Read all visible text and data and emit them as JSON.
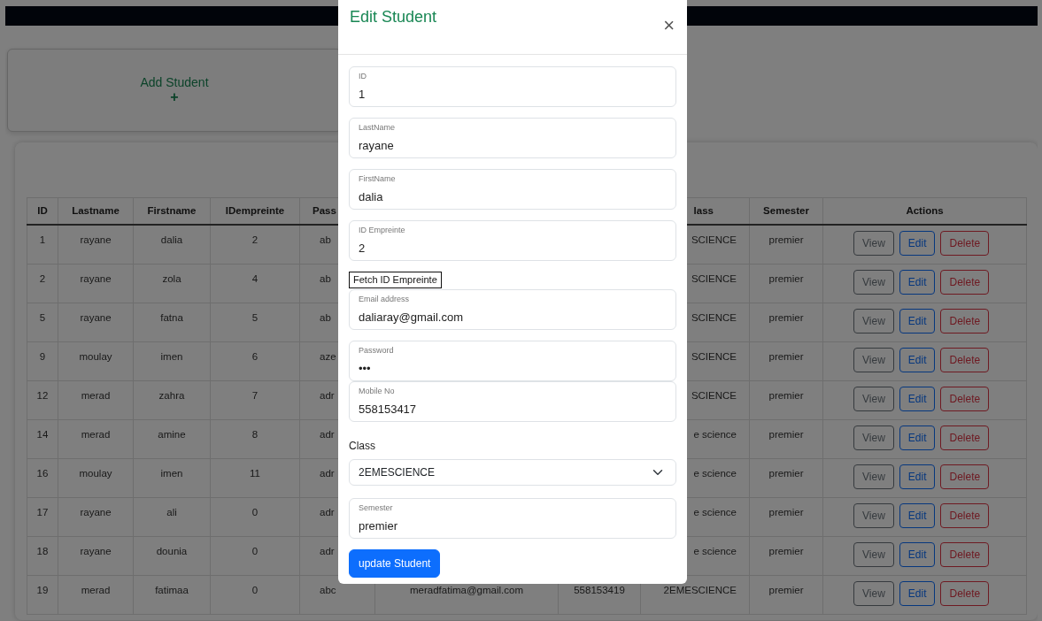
{
  "add_card": {
    "label": "Add Student",
    "icon": "+"
  },
  "table": {
    "columns": [
      "ID",
      "Lastname",
      "Firstname",
      "IDempreinte",
      "Pass",
      null,
      null,
      "lass",
      "Semester",
      "Actions"
    ],
    "rows": [
      {
        "cells": [
          "1",
          "rayane",
          "dalia",
          "2",
          "ab",
          null,
          null,
          "SCIENCE",
          "premier"
        ],
        "actions": [
          {
            "label": "View",
            "kind": "secondary"
          },
          {
            "label": "Edit",
            "kind": "primary"
          },
          {
            "label": "Delete",
            "kind": "danger"
          }
        ]
      },
      {
        "cells": [
          "2",
          "rayane",
          "zola",
          "4",
          "ab",
          null,
          null,
          "SCIENCE",
          "premier"
        ],
        "actions": [
          {
            "label": "View",
            "kind": "secondary"
          },
          {
            "label": "Edit",
            "kind": "primary"
          },
          {
            "label": "Delete",
            "kind": "danger"
          }
        ]
      },
      {
        "cells": [
          "5",
          "rayane",
          "fatna",
          "5",
          "ab",
          null,
          null,
          "SCIENCE",
          "premier"
        ],
        "actions": [
          {
            "label": "View",
            "kind": "secondary"
          },
          {
            "label": "Edit",
            "kind": "primary"
          },
          {
            "label": "Delete",
            "kind": "danger"
          }
        ]
      },
      {
        "cells": [
          "9",
          "moulay",
          "imen",
          "6",
          "aze",
          null,
          null,
          "SCIENCE",
          "premier"
        ],
        "actions": [
          {
            "label": "View",
            "kind": "secondary"
          },
          {
            "label": "Edit",
            "kind": "primary"
          },
          {
            "label": "Delete",
            "kind": "danger"
          }
        ]
      },
      {
        "cells": [
          "12",
          "merad",
          "zahra",
          "7",
          "adr",
          null,
          null,
          "SCIENCE",
          "premier"
        ],
        "actions": [
          {
            "label": "View",
            "kind": "secondary"
          },
          {
            "label": "Edit",
            "kind": "primary"
          },
          {
            "label": "Delete",
            "kind": "danger"
          }
        ]
      },
      {
        "cells": [
          "14",
          "merad",
          "amine",
          "8",
          "adr",
          null,
          null,
          "e science",
          "premier"
        ],
        "actions": [
          {
            "label": "View",
            "kind": "secondary"
          },
          {
            "label": "Edit",
            "kind": "primary"
          },
          {
            "label": "Delete",
            "kind": "danger"
          }
        ]
      },
      {
        "cells": [
          "16",
          "moulay",
          "imen",
          "11",
          "adr",
          null,
          null,
          "e science",
          "premier"
        ],
        "actions": [
          {
            "label": "View",
            "kind": "secondary"
          },
          {
            "label": "Edit",
            "kind": "primary"
          },
          {
            "label": "Delete",
            "kind": "danger"
          }
        ]
      },
      {
        "cells": [
          "17",
          "rayane",
          "ali",
          "0",
          "adr",
          null,
          null,
          "e science",
          "premier"
        ],
        "actions": [
          {
            "label": "View",
            "kind": "secondary"
          },
          {
            "label": "Edit",
            "kind": "primary"
          },
          {
            "label": "Delete",
            "kind": "danger"
          }
        ]
      },
      {
        "cells": [
          "18",
          "rayane",
          "dounia",
          "0",
          "adr",
          null,
          null,
          "e science",
          "premier"
        ],
        "actions": [
          {
            "label": "View",
            "kind": "secondary"
          },
          {
            "label": "Edit",
            "kind": "primary"
          },
          {
            "label": "Delete",
            "kind": "danger"
          }
        ]
      },
      {
        "cells": [
          "19",
          "merad",
          "fatimaa",
          "0",
          "abc",
          "meradfatima@gmail.com",
          "558153419",
          "2EMESCIENCE",
          "premier"
        ],
        "actions": [
          {
            "label": "View",
            "kind": "secondary"
          },
          {
            "label": "Edit",
            "kind": "primary"
          },
          {
            "label": "Delete",
            "kind": "danger"
          }
        ]
      }
    ]
  },
  "modal": {
    "title": "Edit Student",
    "close": "×",
    "fields": [
      {
        "kind": "floating",
        "label": "ID",
        "value": "1"
      },
      {
        "kind": "floating",
        "label": "LastName",
        "value": "rayane"
      },
      {
        "kind": "floating",
        "label": "FirstName",
        "value": "dalia"
      },
      {
        "kind": "floating",
        "label": "ID Empreinte",
        "value": "2"
      },
      {
        "kind": "button",
        "label": "Fetch ID Empreinte"
      },
      {
        "kind": "floating",
        "label": "Email address",
        "value": "daliaray@gmail.com"
      },
      {
        "kind": "floating",
        "label": "Password",
        "value": "•••"
      },
      {
        "kind": "floating",
        "label": "Mobile No",
        "value": "558153417"
      },
      {
        "kind": "select",
        "label": "Class",
        "value": "2EMESCIENCE"
      },
      {
        "kind": "floating",
        "label": "Semester",
        "value": "premier"
      }
    ],
    "submit": "update Student"
  }
}
